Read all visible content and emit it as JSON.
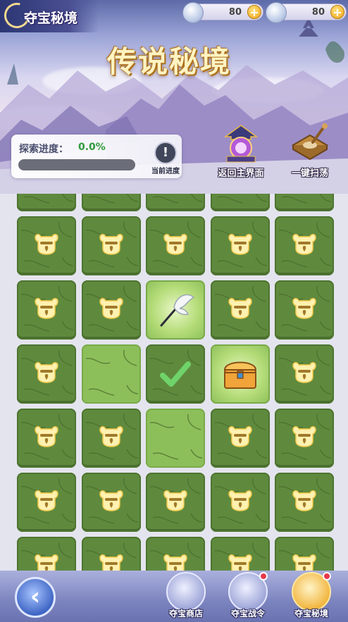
{
  "header": {
    "corner_title": "夺宝秘境",
    "main_title": "传说秘境"
  },
  "currencies": [
    {
      "icon": "silver-coin-icon",
      "amount": "80"
    },
    {
      "icon": "pearl-icon",
      "amount": "80"
    }
  ],
  "progress": {
    "label": "探索进度：",
    "value_text": "0.0%",
    "fraction": 0.0,
    "current_progress_label": "当前进度"
  },
  "actions": {
    "return_label": "返回主界面",
    "sweep_label": "一键扫荡"
  },
  "grid": {
    "columns": 5,
    "rows": [
      [
        "locked",
        "locked",
        "locked",
        "locked",
        "locked"
      ],
      [
        "locked",
        "locked",
        "locked",
        "locked",
        "locked"
      ],
      [
        "locked",
        "locked",
        "feather-quill",
        "locked",
        "locked"
      ],
      [
        "locked",
        "open",
        "cleared",
        "treasure-chest",
        "locked"
      ],
      [
        "locked",
        "locked",
        "open",
        "locked",
        "locked"
      ],
      [
        "locked",
        "locked",
        "locked",
        "locked",
        "locked"
      ],
      [
        "locked",
        "locked",
        "locked",
        "locked",
        "locked"
      ]
    ]
  },
  "nav": {
    "shop_label": "夺宝商店",
    "battle_label": "夺宝战令",
    "realm_label": "夺宝秘境"
  },
  "colors": {
    "tile_locked": "#5f8a3e",
    "tile_open": "#8cbf5a",
    "progress_green": "#2f9a3c",
    "title_gold": "#fff3c2"
  }
}
